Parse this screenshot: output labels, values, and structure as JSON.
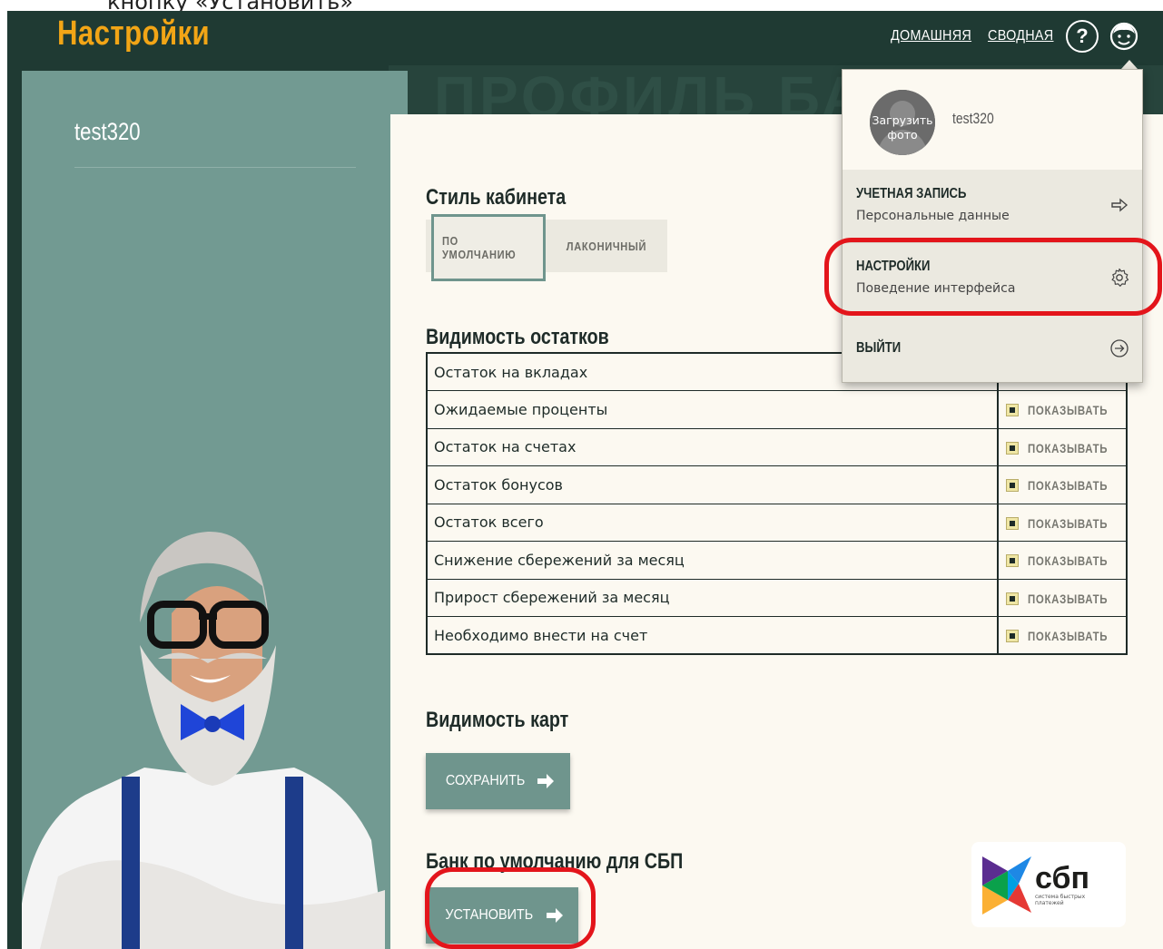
{
  "caption": "кнопку «Установить»",
  "header": {
    "title": "Настройки",
    "nav": [
      "ДОМАШНЯЯ",
      "СВОДНАЯ"
    ],
    "help_label": "?",
    "background_text": "ПРОФИЛЬ БАНК"
  },
  "sidebar": {
    "username": "test320"
  },
  "main": {
    "style_section": {
      "heading": "Стиль кабинета",
      "options": [
        "ПО УМОЛЧАНИЮ",
        "ЛАКОНИЧНЫЙ"
      ],
      "selected": "ПО УМОЛЧАНИЮ"
    },
    "balances_section": {
      "heading": "Видимость остатков",
      "toggle_label": "ПОКАЗЫВАТЬ",
      "rows": [
        "Остаток на вкладах",
        "Ожидаемые проценты",
        "Остаток на счетах",
        "Остаток бонусов",
        "Остаток всего",
        "Снижение сбережений за месяц",
        "Прирост сбережений за месяц",
        "Необходимо внести на счет"
      ]
    },
    "cards_section": {
      "heading": "Видимость карт",
      "save_label": "СОХРАНИТЬ"
    },
    "sbp_section": {
      "heading": "Банк по умолчанию для СБП",
      "set_label": "УСТАНОВИТЬ",
      "logo_word": "сбп",
      "logo_sub": "система быстрых платежей"
    }
  },
  "dropdown": {
    "avatar_label": "Загрузить фото",
    "username": "test320",
    "items": [
      {
        "title": "УЧЕТНАЯ ЗАПИСЬ",
        "subtitle": "Персональные данные",
        "icon": "arrow-right-icon"
      },
      {
        "title": "НАСТРОЙКИ",
        "subtitle": "Поведение интерфейса",
        "icon": "gear-icon"
      },
      {
        "title": "ВЫЙТИ",
        "subtitle": "",
        "icon": "logout-icon"
      }
    ]
  },
  "colors": {
    "header_bg": "#1f3a33",
    "title_orange": "#f2a516",
    "sidebar_bg": "#729a92",
    "content_bg": "#fcf9f1",
    "button_bg": "#6f958d",
    "highlight_red": "#e3151b"
  }
}
